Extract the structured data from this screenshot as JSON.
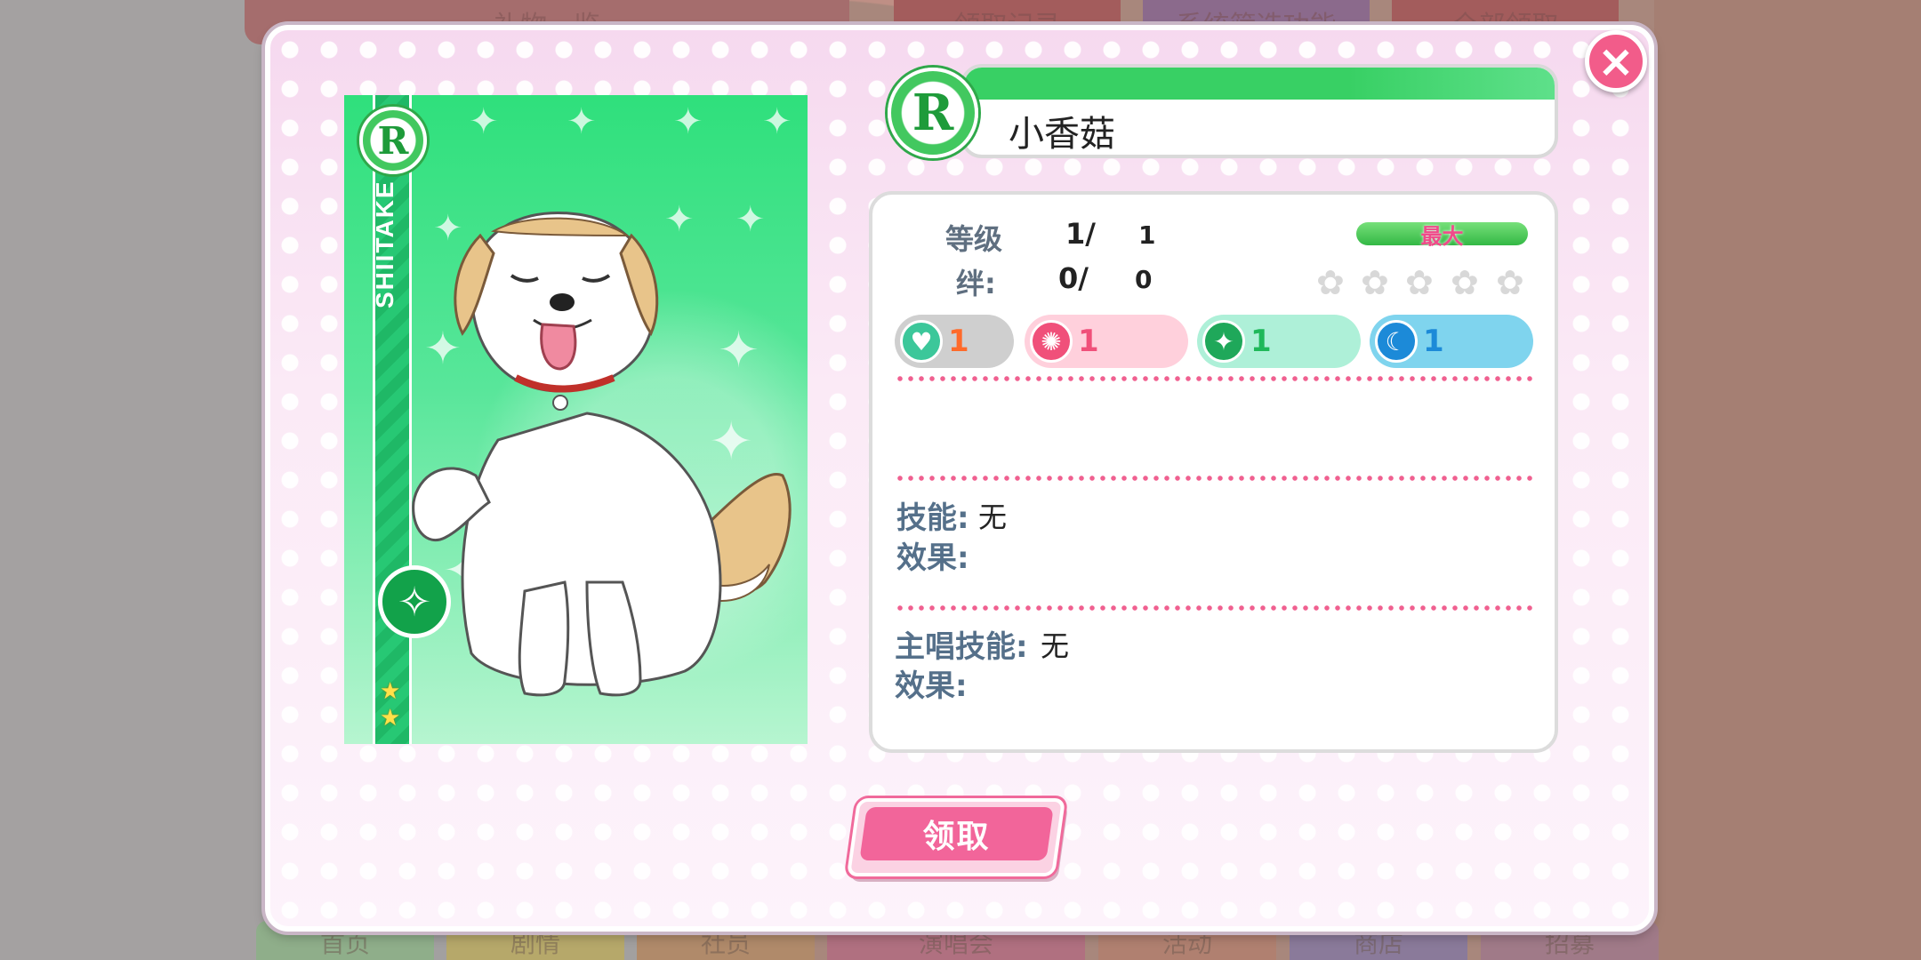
{
  "background": {
    "top_tabs": [
      "礼物一览",
      "领取记录",
      "系统筛选功能",
      "全部领取"
    ],
    "bottom_nav": [
      "首页",
      "剧情",
      "社员",
      "演唱会",
      "活动",
      "商店",
      "招募"
    ]
  },
  "card": {
    "rarity": "R",
    "name_vertical": "SHIITAKE",
    "attribute_icon": "sparkle-diamond-icon",
    "stars": 2
  },
  "header": {
    "rarity": "R",
    "name": "小香菇"
  },
  "stats": {
    "level_label": "等级",
    "level_current": "1/",
    "level_max": "1",
    "bond_label": "绊:",
    "bond_current": "0/",
    "bond_max": "0",
    "max_label": "最大",
    "attributes": [
      {
        "icon": "heart-icon",
        "value": "1",
        "color": "#ff6a2a"
      },
      {
        "icon": "smile-icon",
        "value": "1",
        "color": "#f0507a"
      },
      {
        "icon": "pure-icon",
        "value": "1",
        "color": "#1fb85a"
      },
      {
        "icon": "cool-icon",
        "value": "1",
        "color": "#1c8ad8"
      }
    ]
  },
  "skills": {
    "skill_label": "技能:",
    "skill_value": "无",
    "effect_label": "效果:",
    "center_label": "主唱技能:",
    "center_value": "无",
    "center_effect_label": "效果:"
  },
  "buttons": {
    "claim": "领取",
    "close": "×"
  },
  "colors": {
    "accent_pink": "#f2659a",
    "accent_green": "#38d064"
  }
}
